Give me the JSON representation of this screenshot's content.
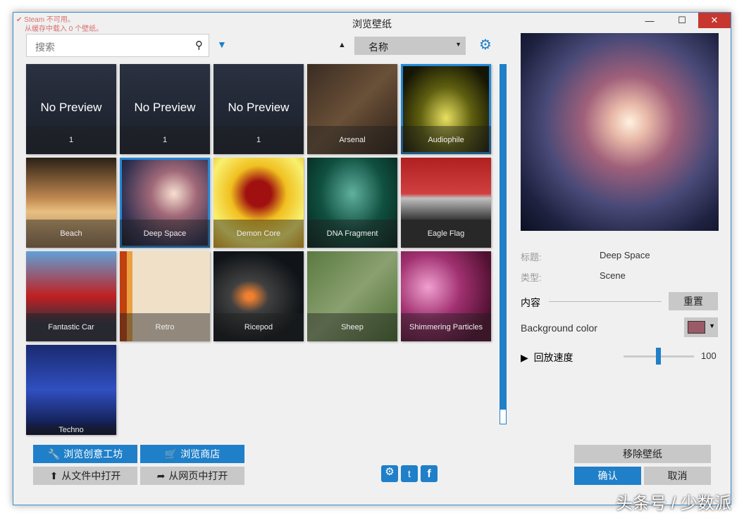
{
  "window": {
    "title": "浏览壁纸",
    "min": "—",
    "max": "☐",
    "close": "✕"
  },
  "status": {
    "line1": "Steam 不可用。",
    "line2": "从缓存中载入 0 个壁纸。"
  },
  "search": {
    "placeholder": "搜索",
    "icon": "search-icon"
  },
  "sort": {
    "direction_icon": "▲",
    "selected": "名称"
  },
  "tiles": [
    {
      "label": "1",
      "no_preview": "No Preview",
      "bg": "linear-gradient(#2a3140,#1a1f2a)"
    },
    {
      "label": "1",
      "no_preview": "No Preview",
      "bg": "linear-gradient(#2a3140,#1a1f2a)"
    },
    {
      "label": "1",
      "no_preview": "No Preview",
      "bg": "linear-gradient(#2a3140,#1a1f2a)"
    },
    {
      "label": "Arsenal",
      "bg": "linear-gradient(135deg,#3a2c22,#6a5038 50%,#2a1e16)"
    },
    {
      "label": "Audiophile",
      "bg": "radial-gradient(ellipse at 50% 60%,#e8e060,#606010 40%,#151505 80%)",
      "selected": true
    },
    {
      "label": "Beach",
      "bg": "linear-gradient(#2a2015,#c08850 45%,#e8c080 60%,#907050)"
    },
    {
      "label": "Deep Space",
      "bg": "radial-gradient(ellipse at 60% 40%,#f8e0d0,#a06878 30%,#303050 70%,#101020)",
      "selected": true
    },
    {
      "label": "Demon Core",
      "bg": "radial-gradient(circle at 50% 40%,#a01010 18%,#f0c020 40%,#f8f070 70%,#e0a010)"
    },
    {
      "label": "DNA Fragment",
      "bg": "radial-gradient(ellipse at 50% 40%,#60b0a0,#105040 50%,#052018)"
    },
    {
      "label": "Eagle Flag",
      "bg": "linear-gradient(#b02020,#d04040 40%,#c0c0c0 45%,#303030 70%)"
    },
    {
      "label": "Fantastic Car",
      "bg": "linear-gradient(#60a0d8,#c02020 50%,#303040 80%)"
    },
    {
      "label": "Retro",
      "bg": "linear-gradient(90deg,#c04010 0 8%,#e8a040 8% 14%,#f0e0c8 14%)"
    },
    {
      "label": "Ricepod",
      "bg": "radial-gradient(ellipse at 40% 50%,#f08030 5%,#404040 25%,#101418 70%)"
    },
    {
      "label": "Sheep",
      "bg": "linear-gradient(135deg,#5a7a40,#8aa070 50%,#4a6a30)"
    },
    {
      "label": "Shimmering Particles",
      "bg": "radial-gradient(circle at 30% 40%,#f0a0d0,#a03070 40%,#501030 80%)"
    },
    {
      "label": "Techno",
      "bg": "linear-gradient(#1a2a70,#3050c0 50%,#0a1030)"
    }
  ],
  "preview": {
    "image": "deep-space-galaxy"
  },
  "details": {
    "title_label": "标题:",
    "title_value": "Deep Space",
    "type_label": "类型:",
    "type_value": "Scene",
    "content_label": "内容",
    "reset": "重置",
    "bgcolor_label": "Background color",
    "bgcolor": "#9b5a68",
    "speed_label": "回放速度",
    "speed_value": "100",
    "speed_fraction": 0.5
  },
  "buttons": {
    "workshop": "浏览创意工坊",
    "store": "浏览商店",
    "open_file": "从文件中打开",
    "open_web": "从网页中打开",
    "remove": "移除壁纸",
    "ok": "确认",
    "cancel": "取消"
  },
  "social": [
    "steam-icon",
    "twitter-icon",
    "facebook-icon"
  ],
  "watermark": "头条号 / 少数派"
}
